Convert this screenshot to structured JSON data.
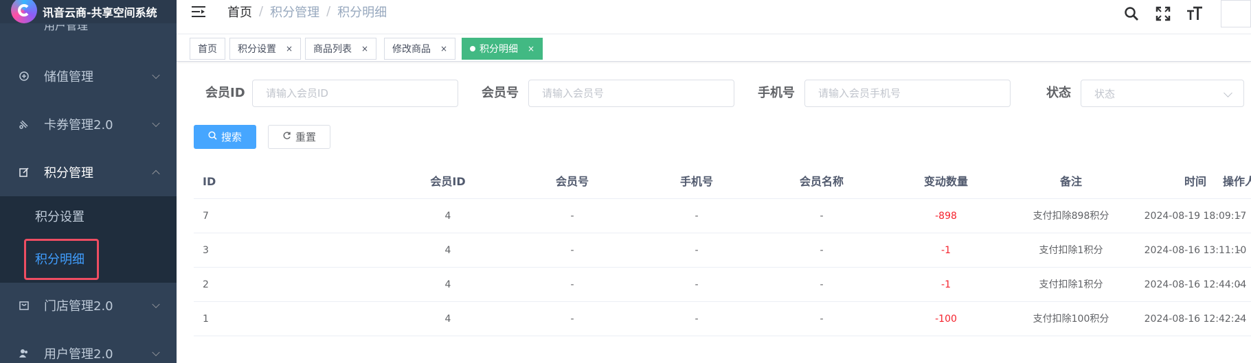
{
  "app": {
    "title": "讯音云商-共享空间系统",
    "cutoff_menu_text": "用户管理"
  },
  "sidebar": {
    "items": [
      {
        "label": "储值管理",
        "icon": "savings-icon"
      },
      {
        "label": "卡券管理2.0",
        "icon": "coupon-icon"
      },
      {
        "label": "积分管理",
        "icon": "edit-icon",
        "expanded": true
      },
      {
        "label": "门店管理2.0",
        "icon": "store-icon"
      },
      {
        "label": "用户管理2.0",
        "icon": "users-icon"
      }
    ],
    "submenu": [
      {
        "label": "积分设置"
      },
      {
        "label": "积分明细",
        "active": true
      }
    ]
  },
  "header": {
    "breadcrumb": [
      "首页",
      "积分管理",
      "积分明细"
    ],
    "tools": [
      "search-icon",
      "fullscreen-icon",
      "font-size-icon",
      "avatar"
    ]
  },
  "tags": [
    {
      "label": "首页",
      "closable": false
    },
    {
      "label": "积分设置",
      "closable": true
    },
    {
      "label": "商品列表",
      "closable": true
    },
    {
      "label": "修改商品",
      "closable": true
    },
    {
      "label": "积分明细",
      "closable": true,
      "active": true
    }
  ],
  "tag_close_glyph": "×",
  "search": {
    "member_id": {
      "label": "会员ID",
      "placeholder": "请输入会员ID",
      "value": ""
    },
    "member_no": {
      "label": "会员号",
      "placeholder": "请输入会员号",
      "value": ""
    },
    "phone": {
      "label": "手机号",
      "placeholder": "请输入会员手机号",
      "value": ""
    },
    "status": {
      "label": "状态",
      "placeholder": "状态"
    },
    "search_button": "搜索",
    "reset_button": "重置"
  },
  "table": {
    "columns": [
      "ID",
      "会员ID",
      "会员号",
      "手机号",
      "会员名称",
      "变动数量",
      "备注",
      "时间",
      "操作人"
    ],
    "rows": [
      [
        "7",
        "4",
        "-",
        "-",
        "-",
        "-898",
        "支付扣除898积分",
        "2024-08-19 18:09:17",
        "-"
      ],
      [
        "3",
        "4",
        "-",
        "-",
        "-",
        "-1",
        "支付扣除1积分",
        "2024-08-16 13:11:10",
        "-"
      ],
      [
        "2",
        "4",
        "-",
        "-",
        "-",
        "-1",
        "支付扣除1积分",
        "2024-08-16 12:44:04",
        "-"
      ],
      [
        "1",
        "4",
        "-",
        "-",
        "-",
        "-100",
        "支付扣除100积分",
        "2024-08-16 12:42:24",
        "-"
      ]
    ]
  },
  "colors": {
    "sidebar_bg": "#304156",
    "active_menu": "#409eff",
    "active_tag": "#42b983",
    "primary_button": "#46a6ff",
    "negative_value": "#f5222d",
    "highlight_box": "#ee4d62"
  }
}
